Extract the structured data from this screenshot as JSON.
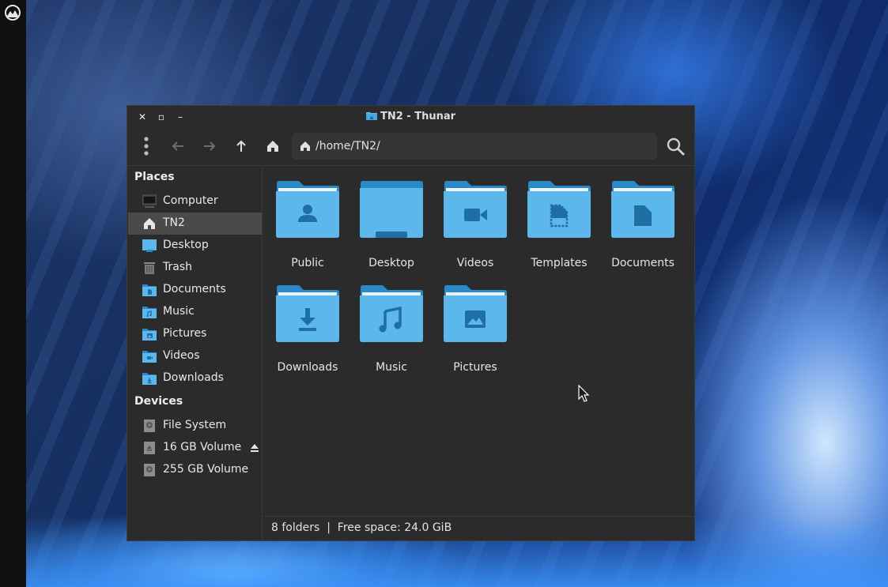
{
  "window": {
    "title": "TN2 - Thunar",
    "controls": {
      "close": "✕",
      "maximize": "▫",
      "minimize": "–"
    }
  },
  "toolbar": {
    "icons": [
      "menu-dots-icon",
      "back-arrow-icon",
      "forward-arrow-icon",
      "up-arrow-icon",
      "home-icon",
      "search-icon"
    ],
    "path": "/home/TN2/"
  },
  "sidebar": {
    "places_heading": "Places",
    "places": [
      {
        "label": "Computer",
        "icon": "computer-icon"
      },
      {
        "label": "TN2",
        "icon": "home-icon",
        "active": true
      },
      {
        "label": "Desktop",
        "icon": "desktop-icon"
      },
      {
        "label": "Trash",
        "icon": "trash-icon"
      },
      {
        "label": "Documents",
        "icon": "documents-folder-icon"
      },
      {
        "label": "Music",
        "icon": "music-folder-icon"
      },
      {
        "label": "Pictures",
        "icon": "pictures-folder-icon"
      },
      {
        "label": "Videos",
        "icon": "videos-folder-icon"
      },
      {
        "label": "Downloads",
        "icon": "downloads-folder-icon"
      }
    ],
    "devices_heading": "Devices",
    "devices": [
      {
        "label": "File System",
        "icon": "drive-icon"
      },
      {
        "label": "16 GB Volume",
        "icon": "removable-drive-icon",
        "eject": true
      },
      {
        "label": "255 GB Volume",
        "icon": "drive-icon"
      }
    ]
  },
  "files": [
    {
      "name": "Public",
      "icon": "public-folder-icon"
    },
    {
      "name": "Desktop",
      "icon": "desktop-folder-icon"
    },
    {
      "name": "Videos",
      "icon": "videos-folder-icon"
    },
    {
      "name": "Templates",
      "icon": "templates-folder-icon"
    },
    {
      "name": "Documents",
      "icon": "documents-folder-icon"
    },
    {
      "name": "Downloads",
      "icon": "downloads-folder-icon"
    },
    {
      "name": "Music",
      "icon": "music-folder-icon"
    },
    {
      "name": "Pictures",
      "icon": "pictures-folder-icon"
    }
  ],
  "statusbar": {
    "text": "8 folders  |  Free space: 24.0 GiB"
  },
  "colors": {
    "folder_light": "#5cb8ec",
    "folder_dark": "#2a8ac8",
    "folder_glyph": "#1f6fa5",
    "window_bg": "#2b2b2b",
    "selection": "#4a4a4a"
  }
}
